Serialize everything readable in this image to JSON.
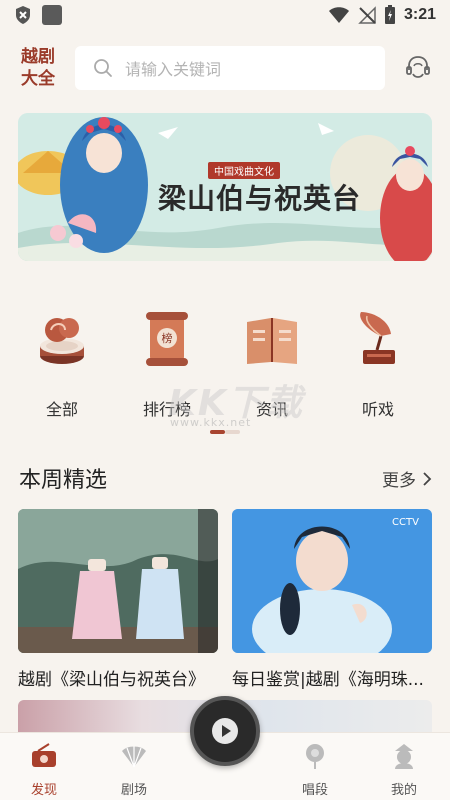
{
  "status_bar": {
    "time": "3:21"
  },
  "header": {
    "logo_line1": "越剧",
    "logo_line2": "大全",
    "search_placeholder": "请输入关键词"
  },
  "banner": {
    "tag": "中国戏曲文化",
    "title": "梁山伯与祝英台"
  },
  "categories": [
    {
      "label": "全部",
      "icon": "disc-icon"
    },
    {
      "label": "排行榜",
      "icon": "scroll-icon"
    },
    {
      "label": "资讯",
      "icon": "book-icon"
    },
    {
      "label": "听戏",
      "icon": "gramophone-icon"
    }
  ],
  "watermark": {
    "main": "KK下载",
    "sub": "www.kkx.net"
  },
  "weekly": {
    "title": "本周精选",
    "more": "更多",
    "cards": [
      {
        "title": "越剧《梁山伯与祝英台》"
      },
      {
        "title": "每日鉴赏|越剧《海明珠..."
      }
    ]
  },
  "tabbar": {
    "items": [
      {
        "label": "发现",
        "active": true
      },
      {
        "label": "剧场",
        "active": false
      },
      {
        "label": "唱段",
        "active": false
      },
      {
        "label": "我的",
        "active": false
      }
    ]
  },
  "colors": {
    "accent": "#a8402c",
    "logo": "#9a3b2a",
    "background": "#f7f3ee"
  }
}
